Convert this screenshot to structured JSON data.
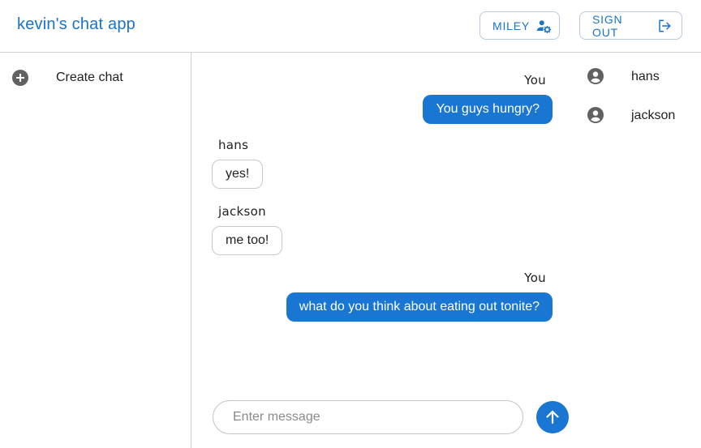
{
  "header": {
    "app_title": "kevin's chat app",
    "user_button": {
      "label": "MILEY",
      "icon": "manage-account-icon"
    },
    "signout_button": {
      "label": "SIGN OUT",
      "icon": "logout-icon"
    }
  },
  "sidebar": {
    "create_chat": {
      "label": "Create chat",
      "icon": "add-circle-icon"
    }
  },
  "chat": {
    "messages": [
      {
        "sender": "You",
        "text": "You guys hungry?",
        "mine": true
      },
      {
        "sender": "hans",
        "text": "yes!",
        "mine": false
      },
      {
        "sender": "jackson",
        "text": "me too!",
        "mine": false
      },
      {
        "sender": "You",
        "text": "what do you think about eating out tonite?",
        "mine": true
      }
    ],
    "input": {
      "placeholder": "Enter message",
      "value": ""
    },
    "send_icon": "arrow-up-icon"
  },
  "members": [
    {
      "name": "hans",
      "icon": "account-circle-icon"
    },
    {
      "name": "jackson",
      "icon": "account-circle-icon"
    }
  ],
  "colors": {
    "accent": "#1976d2",
    "title": "#1a73c7",
    "divider": "#d0d0d0"
  }
}
